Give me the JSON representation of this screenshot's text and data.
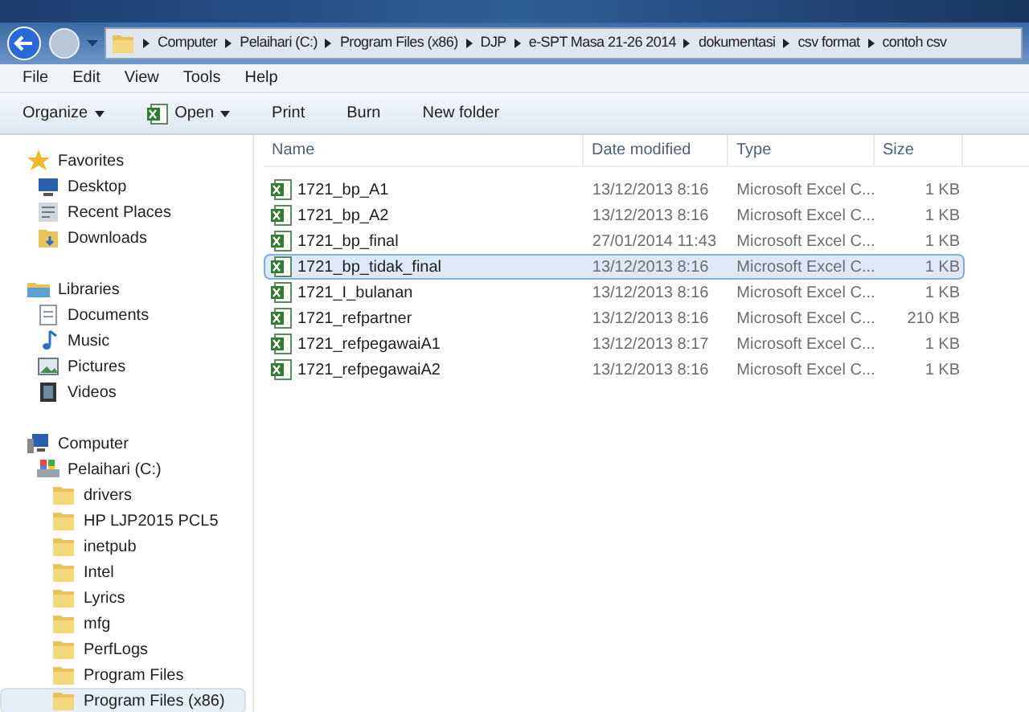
{
  "address_bar": {
    "segments": [
      "Computer",
      "Pelaihari (C:)",
      "Program Files (x86)",
      "DJP",
      "e-SPT Masa 21-26 2014",
      "dokumentasi",
      "csv format",
      "contoh csv"
    ]
  },
  "menu_bar": [
    "File",
    "Edit",
    "View",
    "Tools",
    "Help"
  ],
  "toolbar": [
    {
      "label": "Organize",
      "kind": "dropdown"
    },
    {
      "label": "Open",
      "kind": "excel-dropdown"
    },
    {
      "label": "Print",
      "kind": "plain"
    },
    {
      "label": "Burn",
      "kind": "plain"
    },
    {
      "label": "New folder",
      "kind": "plain"
    }
  ],
  "sidebar": {
    "groups": [
      {
        "label": "Favorites",
        "kind": "star",
        "selected": false,
        "children": [
          {
            "label": "Desktop",
            "kind": "desktop",
            "selected": false
          },
          {
            "label": "Recent Places",
            "kind": "recent",
            "selected": false
          },
          {
            "label": "Downloads",
            "kind": "download",
            "selected": false
          }
        ]
      },
      {
        "label": "Libraries",
        "kind": "library",
        "selected": false,
        "children": [
          {
            "label": "Documents",
            "kind": "document",
            "selected": false
          },
          {
            "label": "Music",
            "kind": "music",
            "selected": false
          },
          {
            "label": "Pictures",
            "kind": "picture",
            "selected": false
          },
          {
            "label": "Videos",
            "kind": "video",
            "selected": false
          }
        ]
      },
      {
        "label": "Computer",
        "kind": "computer",
        "selected": false,
        "children": [
          {
            "label": "Pelaihari (C:)",
            "kind": "drive",
            "selected": false,
            "children": [
              {
                "label": "drivers",
                "kind": "folder",
                "selected": false
              },
              {
                "label": "HP LJP2015 PCL5",
                "kind": "folder",
                "selected": false
              },
              {
                "label": "inetpub",
                "kind": "folder",
                "selected": false
              },
              {
                "label": "Intel",
                "kind": "folder",
                "selected": false
              },
              {
                "label": "Lyrics",
                "kind": "folder",
                "selected": false
              },
              {
                "label": "mfg",
                "kind": "folder",
                "selected": false
              },
              {
                "label": "PerfLogs",
                "kind": "folder",
                "selected": false
              },
              {
                "label": "Program Files",
                "kind": "folder",
                "selected": false
              },
              {
                "label": "Program Files (x86)",
                "kind": "folder",
                "selected": true
              }
            ]
          }
        ]
      }
    ]
  },
  "file_list": {
    "columns": [
      "Name",
      "Date modified",
      "Type",
      "Size"
    ],
    "rows": [
      {
        "name": "1721_bp_A1",
        "date": "13/12/2013 8:16",
        "type": "Microsoft Excel C...",
        "size": "1 KB",
        "selected": false
      },
      {
        "name": "1721_bp_A2",
        "date": "13/12/2013 8:16",
        "type": "Microsoft Excel C...",
        "size": "1 KB",
        "selected": false
      },
      {
        "name": "1721_bp_final",
        "date": "27/01/2014 11:43",
        "type": "Microsoft Excel C...",
        "size": "1 KB",
        "selected": false
      },
      {
        "name": "1721_bp_tidak_final",
        "date": "13/12/2013 8:16",
        "type": "Microsoft Excel C...",
        "size": "1 KB",
        "selected": true
      },
      {
        "name": "1721_I_bulanan",
        "date": "13/12/2013 8:16",
        "type": "Microsoft Excel C...",
        "size": "1 KB",
        "selected": false
      },
      {
        "name": "1721_refpartner",
        "date": "13/12/2013 8:16",
        "type": "Microsoft Excel C...",
        "size": "210 KB",
        "selected": false
      },
      {
        "name": "1721_refpegawaiA1",
        "date": "13/12/2013 8:17",
        "type": "Microsoft Excel C...",
        "size": "1 KB",
        "selected": false
      },
      {
        "name": "1721_refpegawaiA2",
        "date": "13/12/2013 8:16",
        "type": "Microsoft Excel C...",
        "size": "1 KB",
        "selected": false
      }
    ]
  }
}
